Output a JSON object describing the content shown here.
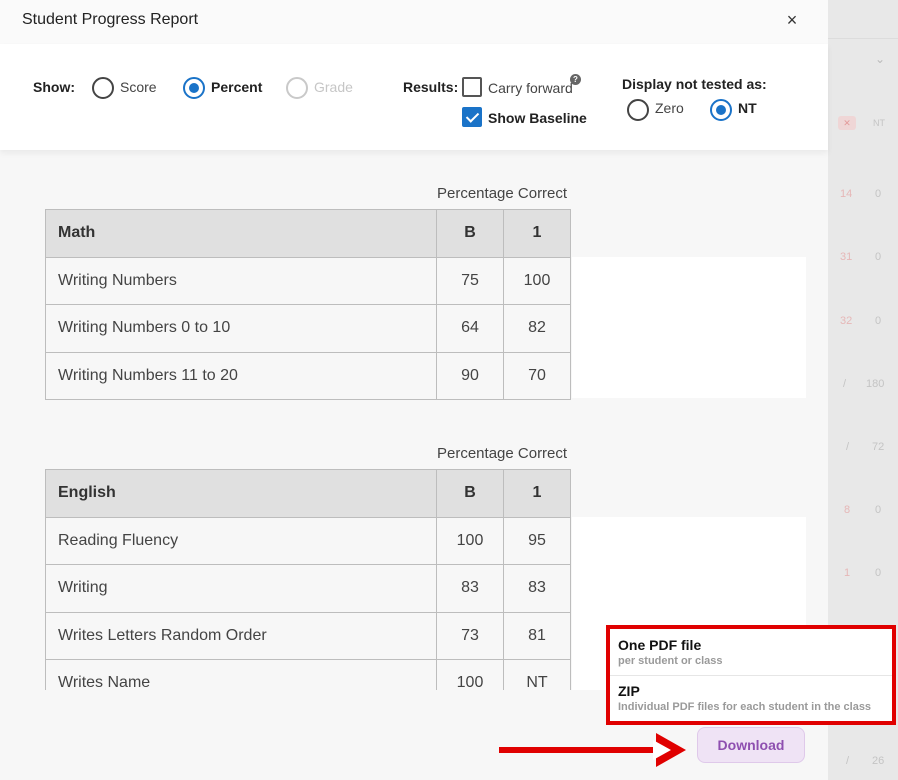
{
  "modal": {
    "title": "Student Progress Report",
    "close": "×"
  },
  "options": {
    "show_label": "Show:",
    "show_options": [
      "Score",
      "Percent",
      "Grade"
    ],
    "show_selected": "Percent",
    "results_label": "Results:",
    "carry_forward": "Carry forward",
    "carry_forward_checked": false,
    "help": "?",
    "show_baseline": "Show Baseline",
    "show_baseline_checked": true,
    "not_tested_label": "Display not tested as:",
    "not_tested_options": [
      "Zero",
      "NT"
    ],
    "not_tested_selected": "NT"
  },
  "tables": [
    {
      "caption": "Percentage Correct",
      "subject": "Math",
      "columns": [
        "B",
        "1"
      ],
      "rows": [
        {
          "name": "Writing Numbers",
          "values": [
            "75",
            "100"
          ]
        },
        {
          "name": "Writing Numbers 0 to 10",
          "values": [
            "64",
            "82"
          ]
        },
        {
          "name": "Writing Numbers 11 to 20",
          "values": [
            "90",
            "70"
          ]
        }
      ]
    },
    {
      "caption": "Percentage Correct",
      "subject": "English",
      "columns": [
        "B",
        "1"
      ],
      "rows": [
        {
          "name": "Reading Fluency",
          "values": [
            "100",
            "95"
          ]
        },
        {
          "name": "Writing",
          "values": [
            "83",
            "83"
          ]
        },
        {
          "name": "Writes Letters Random Order",
          "values": [
            "73",
            "81"
          ]
        },
        {
          "name": "Writes Name",
          "values": [
            "100",
            "NT"
          ]
        }
      ]
    }
  ],
  "download": {
    "button": "Download",
    "menu": [
      {
        "title": "One PDF file",
        "subtitle": "per student or class"
      },
      {
        "title": "ZIP",
        "subtitle": "Individual PDF files for each student in the class"
      }
    ]
  },
  "background": {
    "cells": [
      "NT",
      "14",
      "0",
      "31",
      "0",
      "32",
      "0",
      "/",
      "180",
      "/",
      "72",
      "8",
      "0",
      "1",
      "0",
      "/",
      "26"
    ]
  },
  "colors": {
    "accent": "#1a73c8",
    "highlight": "#e00000",
    "download_text": "#8e4fb0"
  }
}
